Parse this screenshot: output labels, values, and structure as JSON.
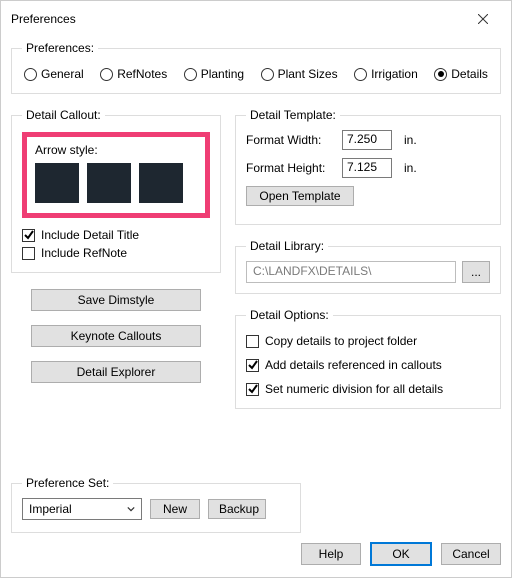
{
  "window": {
    "title": "Preferences"
  },
  "tabs": {
    "legend": "Preferences:",
    "items": [
      {
        "label": "General"
      },
      {
        "label": "RefNotes"
      },
      {
        "label": "Planting"
      },
      {
        "label": "Plant Sizes"
      },
      {
        "label": "Irrigation"
      },
      {
        "label": "Details"
      }
    ],
    "selected_index": 5
  },
  "detail_callout": {
    "legend": "Detail Callout:",
    "arrow_style_label": "Arrow style:",
    "include_title_label": "Include Detail Title",
    "include_title_checked": true,
    "include_refnote_label": "Include RefNote",
    "include_refnote_checked": false
  },
  "left_buttons": {
    "save_dimstyle": "Save Dimstyle",
    "keynote_callouts": "Keynote Callouts",
    "detail_explorer": "Detail Explorer"
  },
  "detail_template": {
    "legend": "Detail Template:",
    "width_label": "Format Width:",
    "width_value": "7.250",
    "height_label": "Format Height:",
    "height_value": "7.125",
    "unit": "in.",
    "open_template": "Open Template"
  },
  "detail_library": {
    "legend": "Detail Library:",
    "path": "C:\\LANDFX\\DETAILS\\",
    "browse_label": "..."
  },
  "detail_options": {
    "legend": "Detail Options:",
    "copy_label": "Copy details to project folder",
    "copy_checked": false,
    "addref_label": "Add details referenced in callouts",
    "addref_checked": true,
    "numeric_label": "Set numeric division for all details",
    "numeric_checked": true
  },
  "preference_set": {
    "legend": "Preference Set:",
    "selected": "Imperial",
    "new": "New",
    "backup": "Backup"
  },
  "footer": {
    "help": "Help",
    "ok": "OK",
    "cancel": "Cancel"
  }
}
